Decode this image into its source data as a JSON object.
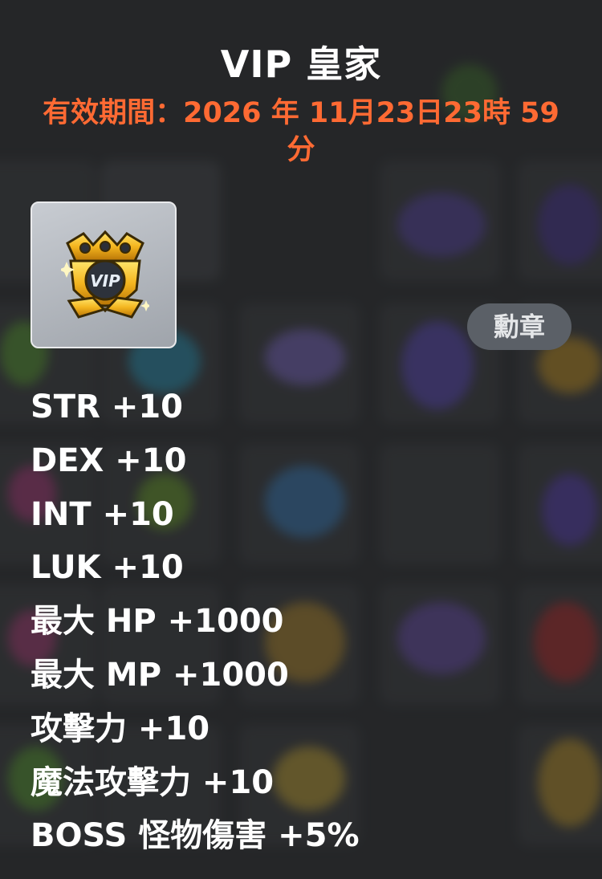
{
  "item": {
    "title": "VIP 皇家",
    "expiry": "有效期間：2026 年 11月23日23時 59 分",
    "category_tag": "勳章",
    "icon": "vip-medal-icon"
  },
  "stats": [
    "STR +10",
    "DEX +10",
    "INT +10",
    "LUK +10",
    "最大 HP +1000",
    "最大 MP +1000",
    "攻擊力 +10",
    "魔法攻擊力 +10",
    "BOSS 怪物傷害 +5%"
  ],
  "colors": {
    "title": "#ffffff",
    "expiry": "#ff6a33",
    "tag_bg": "#5b6067",
    "panel_bg": "#3a3b3d"
  }
}
